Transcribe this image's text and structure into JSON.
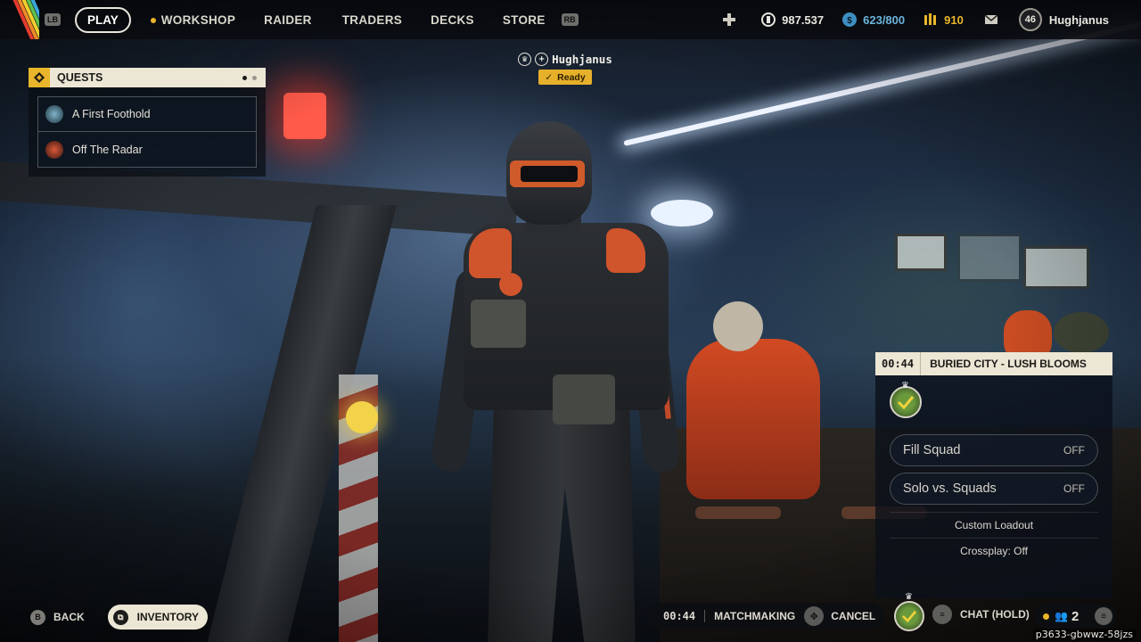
{
  "top_nav": {
    "lb": "LB",
    "rb": "RB",
    "items": [
      "PLAY",
      "WORKSHOP",
      "RAIDER",
      "TRADERS",
      "DECKS",
      "STORE"
    ]
  },
  "currencies": {
    "coins": "987.537",
    "stash": "623/800",
    "raider_tokens": "910",
    "player_level": "46",
    "player_name": "Hughjanus"
  },
  "quests": {
    "title": "QUESTS",
    "items": [
      "A First Foothold",
      "Off The Radar"
    ]
  },
  "player_tag": {
    "name": "Hughjanus",
    "status": "Ready"
  },
  "matchmaking_panel": {
    "timer": "00:44",
    "map": "BURIED CITY - LUSH BLOOMS",
    "options": [
      {
        "label": "Fill Squad",
        "value": "OFF"
      },
      {
        "label": "Solo vs. Squads",
        "value": "OFF"
      }
    ],
    "custom_loadout": "Custom Loadout",
    "crossplay": "Crossplay: Off"
  },
  "bottom_bar": {
    "back_key": "B",
    "back_label": "BACK",
    "inventory_label": "INVENTORY",
    "mm_timer": "00:44",
    "mm_label": "MATCHMAKING",
    "cancel_label": "CANCEL",
    "chat_label": "CHAT (HOLD)",
    "party_count": "2"
  },
  "session_id": "p3633-gbwwz-58jzs",
  "colors": {
    "accent_gold": "#e9b52a",
    "panel_cream": "#ece6d5",
    "ready_yellow": "#e7b02a"
  },
  "icons": [
    "plus-icon",
    "currency-coin-icon",
    "stash-icon",
    "raider-token-icon",
    "mail-icon",
    "quest-icon",
    "crown-icon",
    "check-icon",
    "squad-emblem-icon",
    "menu-icon",
    "party-icon",
    "cancel-key-icon"
  ]
}
